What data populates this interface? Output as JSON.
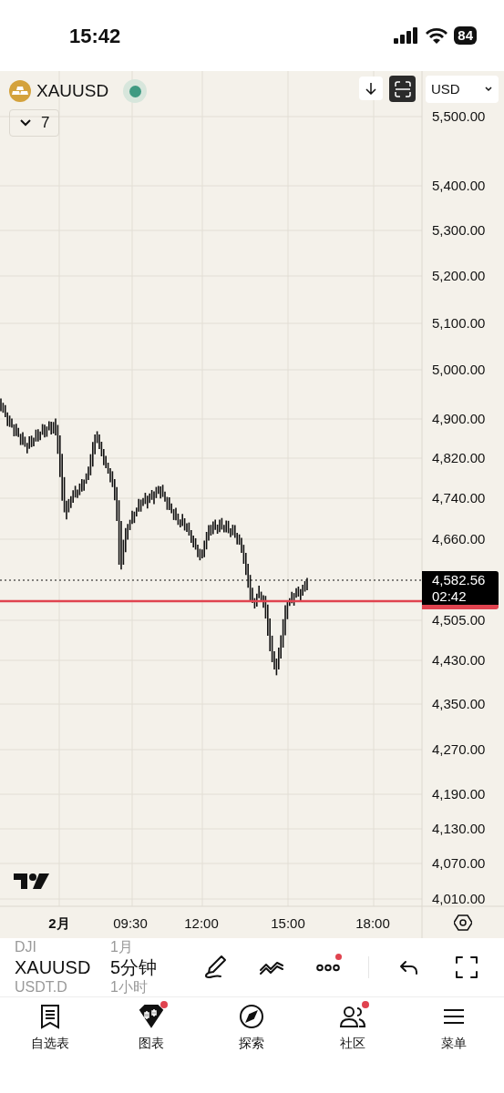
{
  "status_bar": {
    "time": "15:42",
    "battery": "84"
  },
  "chart_header": {
    "symbol": "XAUUSD",
    "market_open": true,
    "currency": "USD",
    "indicators_count": "7"
  },
  "price_axis": [
    "5,500.00",
    "5,400.00",
    "5,300.00",
    "5,200.00",
    "5,100.00",
    "5,000.00",
    "4,900.00",
    "4,820.00",
    "4,740.00",
    "4,660.00",
    "4,505.00",
    "4,430.00",
    "4,350.00",
    "4,270.00",
    "4,190.00",
    "4,130.00",
    "4,070.00",
    "4,010.00"
  ],
  "price_tag": {
    "price": "4,582.56",
    "countdown": "02:42"
  },
  "time_axis": [
    {
      "label": "2月",
      "bold": true
    },
    {
      "label": "09:30",
      "bold": false
    },
    {
      "label": "12:00",
      "bold": false
    },
    {
      "label": "15:00",
      "bold": false
    },
    {
      "label": "18:00",
      "bold": false
    }
  ],
  "symbol_picker": [
    {
      "label": "DJI",
      "selected": false
    },
    {
      "label": "XAUUSD",
      "selected": true
    },
    {
      "label": "USDT.D",
      "selected": false
    }
  ],
  "interval_picker": [
    {
      "label": "1月",
      "selected": false
    },
    {
      "label": "5分钟",
      "selected": true
    },
    {
      "label": "1小时",
      "selected": false
    }
  ],
  "toolbar": [
    {
      "kind": "draw",
      "badge": false
    },
    {
      "kind": "trend",
      "badge": false
    },
    {
      "kind": "more",
      "badge": true
    },
    {
      "kind": "undo",
      "badge": false
    },
    {
      "kind": "fullscreen",
      "badge": false
    }
  ],
  "bottom_nav": [
    {
      "kind": "watchlist",
      "label": "自选表",
      "selected": false,
      "badge": false
    },
    {
      "kind": "chart",
      "label": "图表",
      "selected": true,
      "badge": true
    },
    {
      "kind": "explore",
      "label": "探索",
      "selected": false,
      "badge": false
    },
    {
      "kind": "community",
      "label": "社区",
      "selected": false,
      "badge": true
    },
    {
      "kind": "menu",
      "label": "菜单",
      "selected": false,
      "badge": false
    }
  ]
}
